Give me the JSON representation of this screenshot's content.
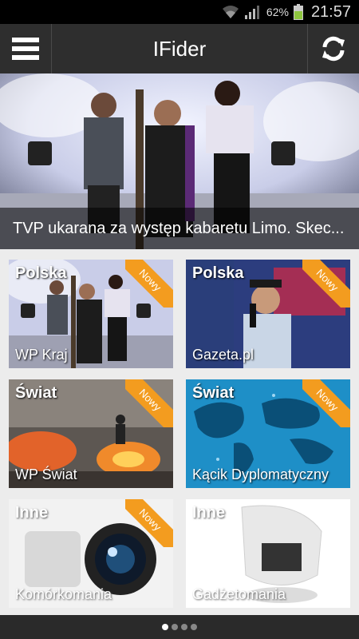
{
  "status": {
    "battery": "62%",
    "time": "21:57"
  },
  "header": {
    "title": "IFider",
    "menu_icon": "hamburger-menu-icon",
    "refresh_icon": "refresh-icon"
  },
  "hero": {
    "caption": "TVP ukarana za występ kabaretu Limo. Skec..."
  },
  "tiles": [
    {
      "category": "Polska",
      "source": "WP Kraj",
      "badge": "Nowy"
    },
    {
      "category": "Polska",
      "source": "Gazeta.pl",
      "badge": "Nowy"
    },
    {
      "category": "Świat",
      "source": "WP Świat",
      "badge": "Nowy"
    },
    {
      "category": "Świat",
      "source": "Kącik Dyplomatyczny",
      "badge": "Nowy"
    },
    {
      "category": "Inne",
      "source": "Komórkomania",
      "badge": "Nowy"
    },
    {
      "category": "Inne",
      "source": "Gadżetomania"
    }
  ],
  "pager": {
    "pages": 4,
    "current": 1
  },
  "colors": {
    "badge": "#f39c1f",
    "actionbar": "#2e2e2e",
    "battery": "#8ec63f"
  }
}
